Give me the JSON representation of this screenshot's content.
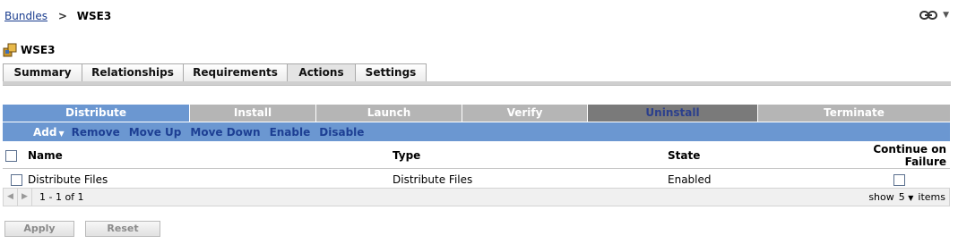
{
  "breadcrumb": {
    "parent": "Bundles",
    "separator": ">",
    "current": "WSE3"
  },
  "tools": {
    "caret": "▼",
    "icon": "link-chain-icon"
  },
  "bundle": {
    "title": "WSE3",
    "icon": "bundle-box-icon"
  },
  "main_tabs": [
    {
      "label": "Summary",
      "active": false
    },
    {
      "label": "Relationships",
      "active": false
    },
    {
      "label": "Requirements",
      "active": false
    },
    {
      "label": "Actions",
      "active": true
    },
    {
      "label": "Settings",
      "active": false
    }
  ],
  "phase_tabs": [
    {
      "label": "Distribute",
      "state": "active"
    },
    {
      "label": "Install",
      "state": "normal"
    },
    {
      "label": "Launch",
      "state": "normal"
    },
    {
      "label": "Verify",
      "state": "normal"
    },
    {
      "label": "Uninstall",
      "state": "dark"
    },
    {
      "label": "Terminate",
      "state": "normal"
    }
  ],
  "toolbar": {
    "add": "Add",
    "remove": "Remove",
    "move_up": "Move Up",
    "move_down": "Move Down",
    "enable": "Enable",
    "disable": "Disable"
  },
  "table": {
    "columns": [
      "Name",
      "Type",
      "State",
      "Continue on Failure"
    ],
    "rows": [
      {
        "name": "Distribute Files",
        "type": "Distribute Files",
        "state": "Enabled",
        "continue_on_failure": false
      }
    ]
  },
  "pager": {
    "range": "1 - 1 of 1",
    "show_label": "show",
    "page_size": "5",
    "items_label": "items"
  },
  "buttons": {
    "apply": "Apply",
    "reset": "Reset"
  },
  "colors": {
    "accent": "#6b97d1",
    "link": "#1a3d8f",
    "toolbar_text": "#1d3f93",
    "tab_inactive": "#b5b5b5"
  }
}
